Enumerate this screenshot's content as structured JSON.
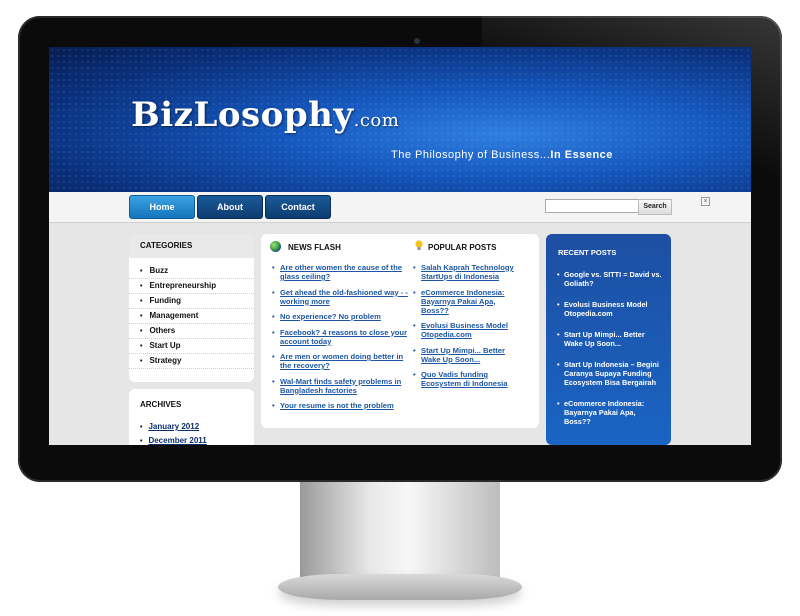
{
  "site": {
    "logo": "BizLosophy",
    "logo_suffix": ".com",
    "tagline_prefix": "The Philosophy of Business...",
    "tagline_bold": "In Essence"
  },
  "nav": {
    "items": [
      {
        "label": "Home",
        "active": true
      },
      {
        "label": "About",
        "active": false
      },
      {
        "label": "Contact",
        "active": false
      }
    ],
    "search_value": "",
    "search_button": "Search",
    "close_symbol": "×"
  },
  "sidebar": {
    "categories_title": "CATEGORIES",
    "categories": [
      "Buzz",
      "Entrepreneurship",
      "Funding",
      "Management",
      "Others",
      "Start Up",
      "Strategy"
    ],
    "archives_title": "ARCHIVES",
    "archives": [
      "January 2012",
      "December 2011"
    ]
  },
  "news_flash": {
    "title": "NEWS FLASH",
    "icon": "globe-icon",
    "items": [
      "Are other women the cause of the glass ceiling?",
      "Get ahead the old-fashioned way - - working more",
      "No experience? No problem",
      "Facebook? 4 reasons to close your account today",
      "Are men or women doing better in the recovery?",
      "Wal-Mart finds safety problems in Bangladesh factories",
      "Your resume is not the problem"
    ]
  },
  "popular_posts": {
    "title": "POPULAR POSTS",
    "icon": "lightbulb-icon",
    "items": [
      "Salah Kaprah Technology StartUps di Indonesia",
      "eCommerce Indonesia: Bayarnya Pakai Apa, Boss??",
      "Evolusi Business Model Otopedia.com",
      "Start Up Mimpi... Better Wake Up Soon...",
      "Quo Vadis funding Ecosystem di Indonesia"
    ]
  },
  "recent_posts": {
    "title": "RECENT POSTS",
    "items": [
      "Google vs. SITTI = David vs. Goliath?",
      "Evolusi Business Model Otopedia.com",
      "Start Up Mimpi... Better Wake Up Soon...",
      "Start Up Indonesia – Begini Caranya Supaya Funding Ecosystem Bisa Bergairah",
      "eCommerce Indonesia: Bayarnya Pakai Apa, Boss??"
    ]
  },
  "colors": {
    "nav_active": "#1574bb",
    "nav_default": "#0e3d70",
    "link": "#1d57a4",
    "recent_bg": "#1a5ab5"
  }
}
